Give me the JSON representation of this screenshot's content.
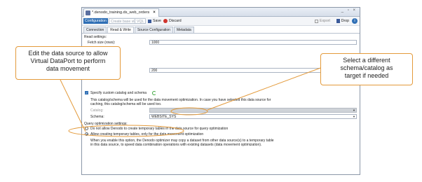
{
  "window": {
    "tab_title": "*.denodo_training.ds_web_orders",
    "tab_close": "×",
    "controls": "_ ▫ ×"
  },
  "toolbar": {
    "configuration": "Configuration",
    "create_base_view": "Create base view",
    "vql": "VQL",
    "save": "Save",
    "discard": "Discard",
    "export": "Export",
    "drop": "Drop",
    "help": "i"
  },
  "tabs": [
    "Connection",
    "Read & Write",
    "Source Configuration",
    "Metadata"
  ],
  "read_settings": {
    "heading": "Read settings:",
    "fetch_label": "Fetch size (rows):",
    "fetch_value": "1000",
    "second_value": "200"
  },
  "custom_catalog": {
    "checkbox_label": "Specify custom catalog and schema",
    "description_line1": "This catalog/schema will be used for the data movement optimization. In case you have selected this data source for",
    "description_line2": "caching, this catalog/schema will be used too.",
    "catalog_label": "Catalog:",
    "catalog_value": "",
    "schema_label": "Schema:",
    "schema_value": "WEBSITE_SYS"
  },
  "query_optimization": {
    "heading": "Query optimization settings:",
    "option1": "Do not allow Denodo to create temporary tables in the data source for query optimization",
    "option2": "Allow creating temporary tables, only for the data movement optimization",
    "note_line1": "When you enable this option, the Denodo optimizer may copy a dataset from other data source(s) to a temporary table",
    "note_line2": "in this data source, to speed data combination operations with existing datasets (data movement optimization)."
  },
  "callouts": {
    "left": [
      "Edit the data source to allow",
      "Virtual DataPort to perform",
      "data movement"
    ],
    "right": [
      "Select a different",
      "schema/catalog as",
      "target if needed"
    ]
  },
  "colors": {
    "accent": "#2f6fb5",
    "callout_border": "#e39a3b",
    "discard": "#d0342c"
  }
}
